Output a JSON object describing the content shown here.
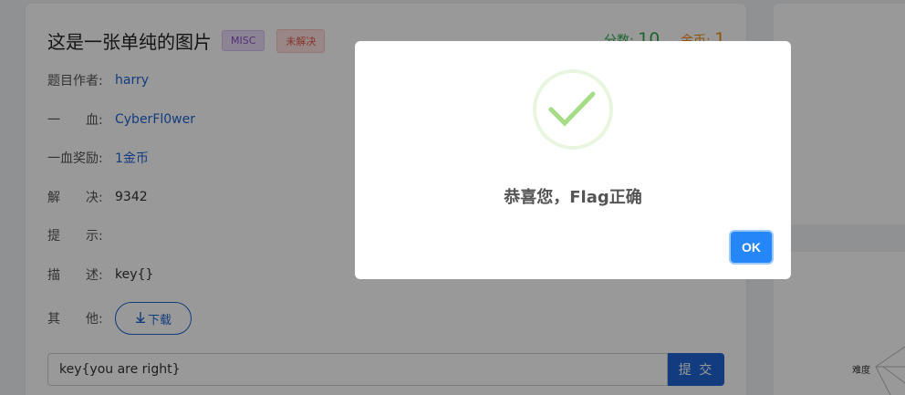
{
  "challenge": {
    "title": "这是一张单纯的图片",
    "category_tag": "MISC",
    "status_tag": "未解决",
    "points_label": "分数:",
    "points_value": "10",
    "coins_label": "金币:",
    "coins_value": "1"
  },
  "details": {
    "author_label": "题目作者:",
    "author_value": "harry",
    "first_blood_label": "一　　血:",
    "first_blood_value": "CyberFl0wer",
    "first_blood_reward_label": "一血奖励:",
    "first_blood_reward_value": "1金币",
    "solves_label": "解　　决:",
    "solves_value": "9342",
    "hint_label": "提　　示:",
    "hint_value": "",
    "description_label": "描　　述:",
    "description_value": "key{}",
    "other_label": "其　　他:",
    "download_label": "下载"
  },
  "answer": {
    "input_value": "key{you are right}",
    "submit_label": "提 交"
  },
  "radar": {
    "difficulty_label": "难度"
  },
  "modal": {
    "message": "恭喜您，Flag正确",
    "ok_label": "OK"
  },
  "colors": {
    "primary": "#1f64d1",
    "points": "#2fa84f",
    "coins": "#f08c1c",
    "ok_button": "#2586f7",
    "check": "#a5dc86"
  },
  "icons": {
    "download": "arrow-down-icon",
    "success": "checkmark-icon"
  }
}
